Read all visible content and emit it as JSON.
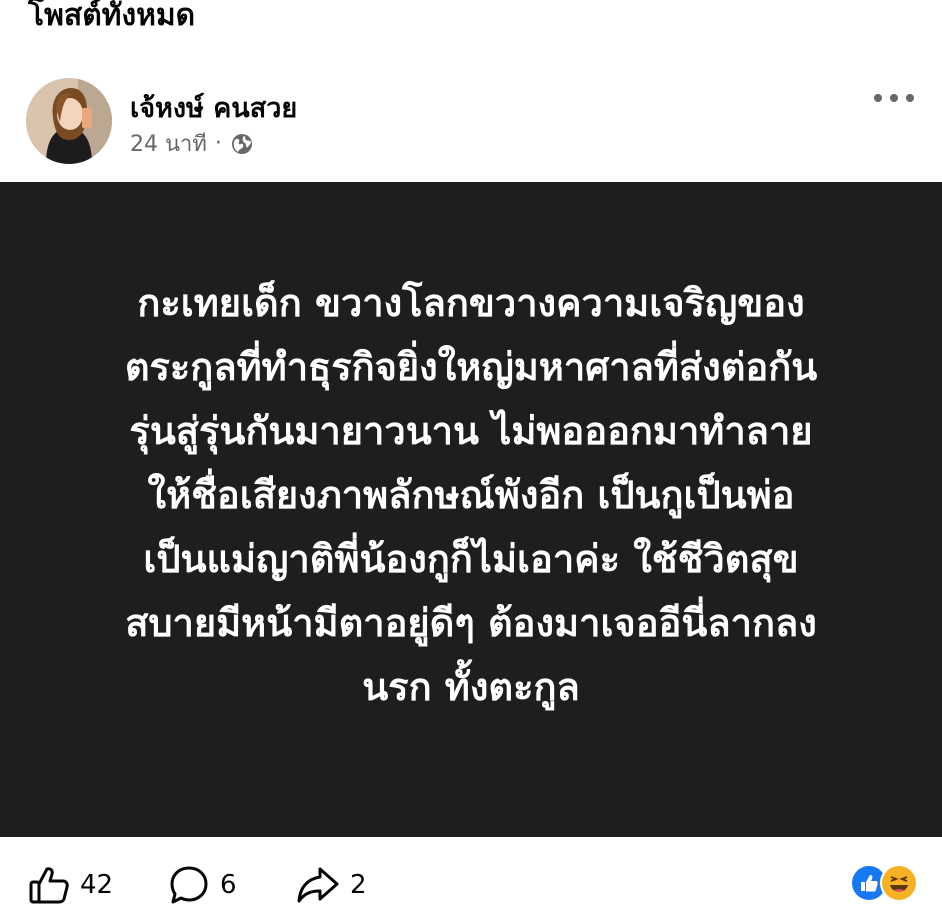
{
  "header": {
    "title": "โพสต์ทั้งหมด"
  },
  "post": {
    "author": "เจ้หงษ์ คนสวย",
    "time": "24 นาที",
    "separator": "·",
    "privacy_icon": "globe-icon",
    "body_lines": [
      "กะเทยเด็ก ขวางโลกขวางความเจริญของ",
      "ตระกูลที่ทำธุรกิจยิ่งใหญ่มหาศาลที่ส่งต่อกัน",
      "รุ่นสู่รุ่นกันมายาวนาน ไม่พอออกมาทำลาย",
      "ให้ชื่อเสียงภาพลักษณ์พังอีก เป็นกูเป็นพ่อ",
      "เป็นแม่ญาติพี่น้องกูก็ไม่เอาค่ะ ใช้ชีวิตสุข",
      "สบายมีหน้ามีตาอยู่ดีๆ ต้องมาเจออีนี่ลากลง",
      "นรก ทั้งตะกูล"
    ],
    "background_color": "#1e1e1e"
  },
  "footer": {
    "likes": "42",
    "comments": "6",
    "shares": "2",
    "reaction_icons": [
      "like-reaction-icon",
      "haha-reaction-icon"
    ]
  }
}
